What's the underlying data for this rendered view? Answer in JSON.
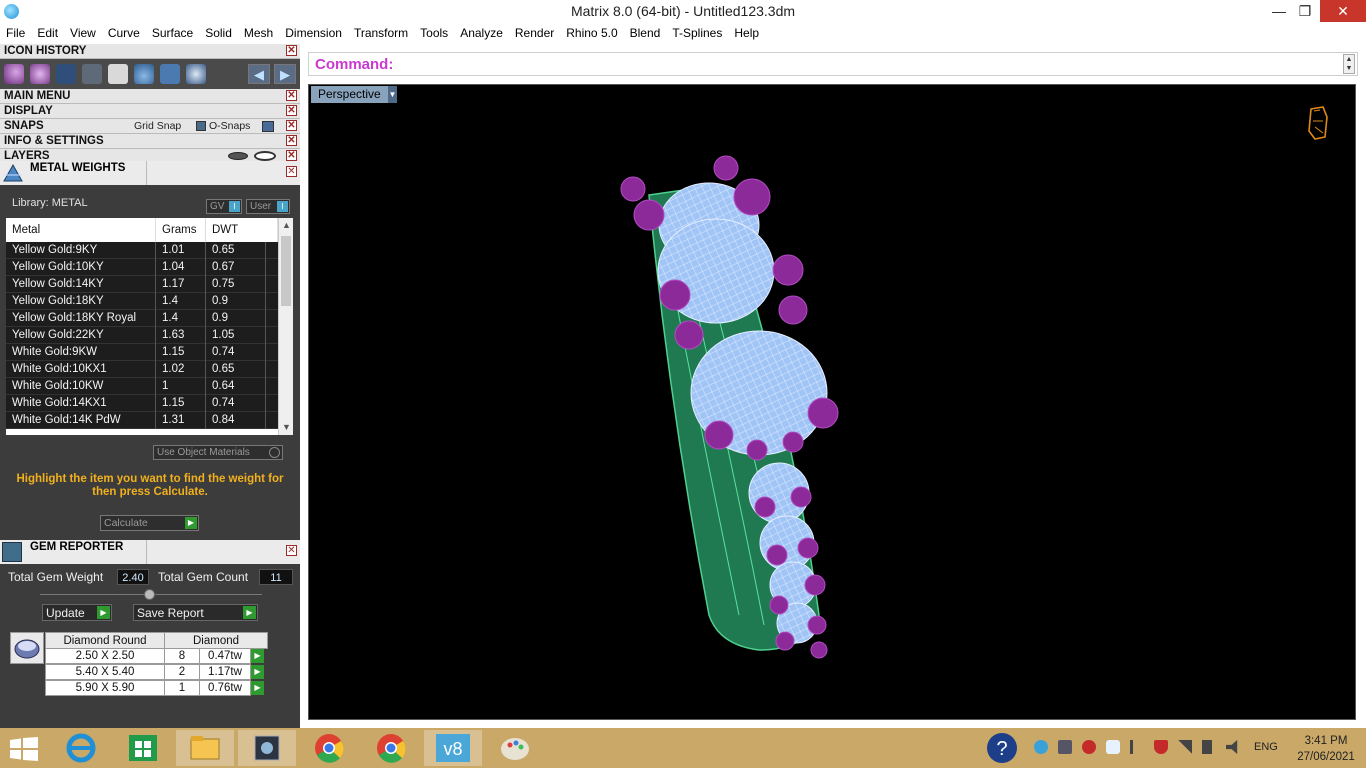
{
  "window": {
    "title": "Matrix 8.0 (64-bit) - Untitled123.3dm",
    "minimize": "—",
    "restore": "❐",
    "close": "✕"
  },
  "menu": [
    "File",
    "Edit",
    "View",
    "Curve",
    "Surface",
    "Solid",
    "Mesh",
    "Dimension",
    "Transform",
    "Tools",
    "Analyze",
    "Render",
    "Rhino 5.0",
    "Blend",
    "T-Splines",
    "Help"
  ],
  "panel": {
    "icon_history": "ICON HISTORY",
    "main_menu": "MAIN MENU",
    "display": "DISPLAY",
    "snaps": "SNAPS",
    "grid_snap": "Grid Snap",
    "o_snaps": "O-Snaps",
    "info_settings": "INFO & SETTINGS",
    "layers": "LAYERS",
    "close_glyph": "✕"
  },
  "metal_weights": {
    "title": "METAL WEIGHTS",
    "library": "Library: METAL",
    "gv": "GV",
    "user": "User",
    "columns": [
      "Metal",
      "Grams",
      "DWT"
    ],
    "rows": [
      [
        "Yellow Gold:9KY",
        "1.01",
        "0.65"
      ],
      [
        "Yellow Gold:10KY",
        "1.04",
        "0.67"
      ],
      [
        "Yellow Gold:14KY",
        "1.17",
        "0.75"
      ],
      [
        "Yellow Gold:18KY",
        "1.4",
        "0.9"
      ],
      [
        "Yellow Gold:18KY Royal",
        "1.4",
        "0.9"
      ],
      [
        "Yellow Gold:22KY",
        "1.63",
        "1.05"
      ],
      [
        "White Gold:9KW",
        "1.15",
        "0.74"
      ],
      [
        "White Gold:10KX1",
        "1.02",
        "0.65"
      ],
      [
        "White Gold:10KW",
        "1",
        "0.64"
      ],
      [
        "White Gold:14KX1",
        "1.15",
        "0.74"
      ],
      [
        "White Gold:14K PdW",
        "1.31",
        "0.84"
      ]
    ],
    "use_object_materials": "Use Object Materials",
    "hint": "Highlight the item you want to find the weight for then press Calculate.",
    "calculate": "Calculate"
  },
  "gem_reporter": {
    "title": "GEM REPORTER",
    "total_weight_label": "Total Gem Weight",
    "total_weight": "2.40",
    "total_count_label": "Total Gem Count",
    "total_count": "11",
    "update": "Update",
    "save_report": "Save Report",
    "headers": [
      "Diamond Round",
      "Diamond"
    ],
    "rows": [
      [
        "2.50 X 2.50",
        "8",
        "0.47tw"
      ],
      [
        "5.40 X 5.40",
        "2",
        "1.17tw"
      ],
      [
        "5.90 X 5.90",
        "1",
        "0.76tw"
      ]
    ]
  },
  "command": {
    "label": "Command:",
    "value": ""
  },
  "viewport": {
    "name": "Perspective"
  },
  "taskbar": {
    "lang": "ENG",
    "time": "3:41 PM",
    "date": "27/06/2021"
  },
  "colors": {
    "panel_bg": "#3c3c3c",
    "viewport_bg": "#000000",
    "ring_green": "#1f7a52",
    "gem_blue": "#9fc4f5",
    "prong_purple": "#8d2a9a",
    "taskbar": "#c9a868",
    "command_label": "#c83ad0",
    "hint_text": "#f2b01e"
  }
}
